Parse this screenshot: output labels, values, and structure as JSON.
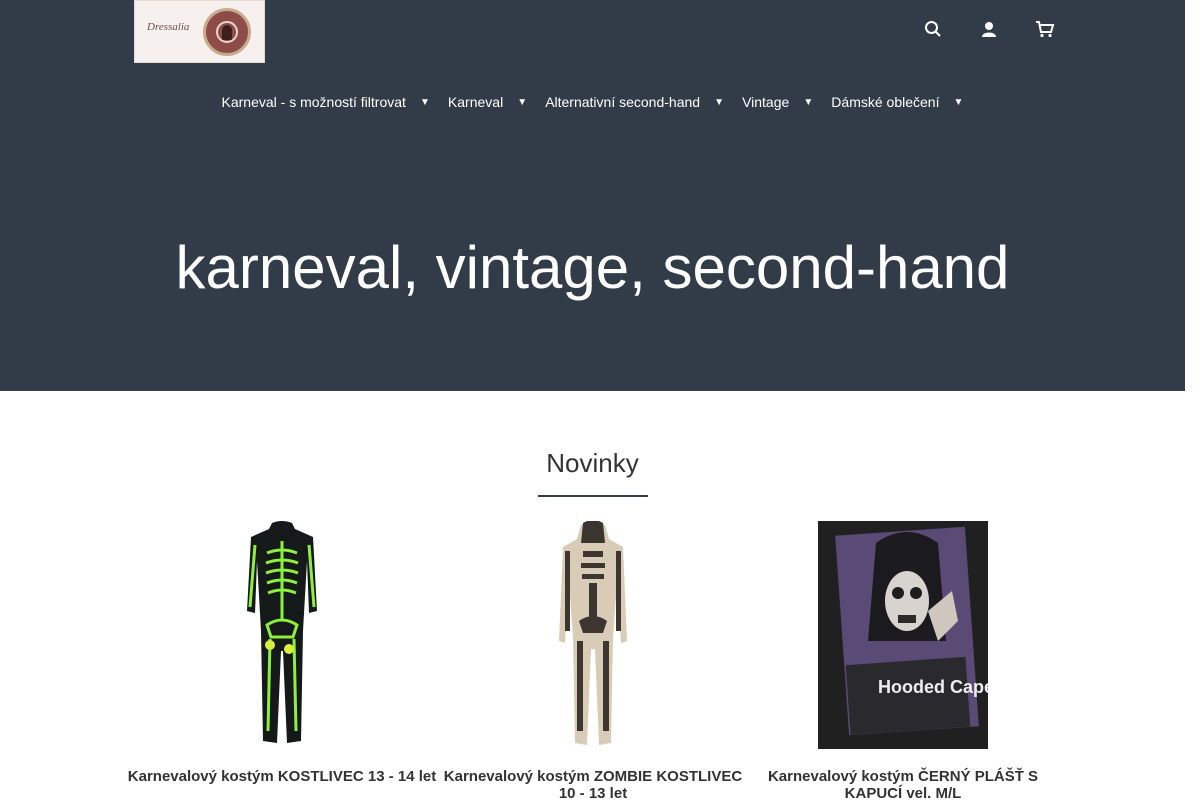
{
  "header": {
    "logo_text": "Dressalia",
    "icons": [
      "search-icon",
      "user-icon",
      "cart-icon"
    ]
  },
  "nav": {
    "items": [
      {
        "label": "Karneval - s možností filtrovat"
      },
      {
        "label": "Karneval"
      },
      {
        "label": "Alternativní second-hand"
      },
      {
        "label": "Vintage"
      },
      {
        "label": "Dámské oblečení"
      }
    ]
  },
  "hero": {
    "title": "karneval, vintage, second-hand",
    "background": "#323b48"
  },
  "section": {
    "title": "Novinky"
  },
  "products": [
    {
      "name": "Karnevalový kostým KOSTLIVEC 13 - 14 let"
    },
    {
      "name": "Karnevalový kostým ZOMBIE KOSTLIVEC 10 - 13 let"
    },
    {
      "name": "Karnevalový kostým ČERNÝ PLÁŠŤ S KAPUCÍ vel. M/L"
    }
  ],
  "cape_pack_text": "Hooded Cape"
}
